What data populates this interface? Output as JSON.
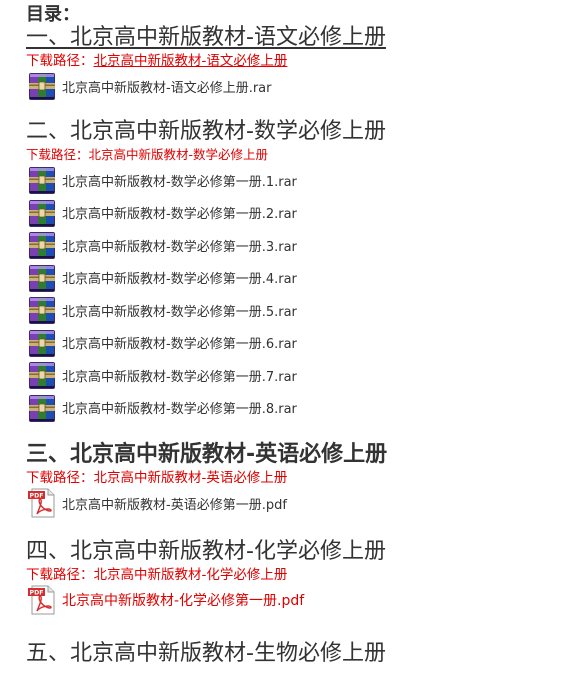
{
  "toc_label": "目录：",
  "path_prefix": "下载路径：",
  "sections": [
    {
      "heading": "一、北京高中新版教材-语文必修上册",
      "path": "北京高中新版教材-语文必修上册",
      "files": [
        {
          "name": "北京高中新版教材-语文必修上册.rar",
          "icon": "winrar-archive-icon"
        }
      ]
    },
    {
      "heading": "二、北京高中新版教材-数学必修上册",
      "path": "北京高中新版教材-数学必修上册",
      "files": [
        {
          "name": "北京高中新版教材-数学必修第一册.1.rar",
          "icon": "winrar-archive-icon"
        },
        {
          "name": "北京高中新版教材-数学必修第一册.2.rar",
          "icon": "winrar-archive-icon"
        },
        {
          "name": "北京高中新版教材-数学必修第一册.3.rar",
          "icon": "winrar-archive-icon"
        },
        {
          "name": "北京高中新版教材-数学必修第一册.4.rar",
          "icon": "winrar-archive-icon"
        },
        {
          "name": "北京高中新版教材-数学必修第一册.5.rar",
          "icon": "winrar-archive-icon"
        },
        {
          "name": "北京高中新版教材-数学必修第一册.6.rar",
          "icon": "winrar-archive-icon"
        },
        {
          "name": "北京高中新版教材-数学必修第一册.7.rar",
          "icon": "winrar-archive-icon"
        },
        {
          "name": "北京高中新版教材-数学必修第一册.8.rar",
          "icon": "winrar-archive-icon"
        }
      ]
    },
    {
      "heading": "三、北京高中新版教材-英语必修上册",
      "path": "北京高中新版教材-英语必修上册",
      "files": [
        {
          "name": "北京高中新版教材-英语必修第一册.pdf",
          "icon": "pdf-file-icon"
        }
      ]
    },
    {
      "heading": "四、北京高中新版教材-化学必修上册",
      "path": "北京高中新版教材-化学必修上册",
      "files": [
        {
          "name": "北京高中新版教材-化学必修第一册.pdf",
          "icon": "pdf-file-icon"
        }
      ]
    },
    {
      "heading": "五、北京高中新版教材-生物必修上册"
    }
  ],
  "colors": {
    "path_red": "#e00000",
    "text": "#333333"
  }
}
